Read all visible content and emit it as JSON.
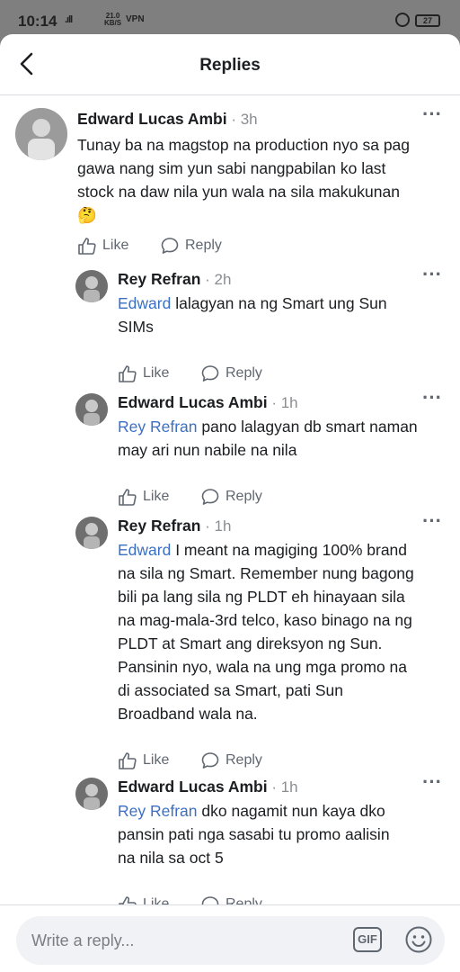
{
  "status_bar": {
    "time": "10:14",
    "signal": ".ıll",
    "speed_value": "21.0",
    "speed_unit": "KB/S",
    "vpn": "VPN",
    "battery": "27"
  },
  "header": {
    "title": "Replies",
    "back_icon": "chevron-left-icon"
  },
  "actions": {
    "like_label": "Like",
    "reply_label": "Reply"
  },
  "comments": [
    {
      "author": "Edward Lucas Ambi",
      "time": " · 3h",
      "lines": [
        "Tunay ba na magstop na production nyo sa pag",
        "gawa nang sim yun sabi nangpabilan ko last",
        "stock na daw nila yun wala na sila makukunan",
        "🤔"
      ]
    },
    {
      "author": "Rey Refran",
      "time": " · 2h",
      "mention": "Edward",
      "lines": [
        " lalagyan na ng Smart ung Sun",
        "SIMs"
      ]
    },
    {
      "author": "Edward Lucas Ambi",
      "time": " · 1h",
      "mention": "Rey Refran",
      "lines": [
        " pano lalagyan db smart naman",
        "may ari nun nabile na nila"
      ]
    },
    {
      "author": "Rey Refran",
      "time": " · 1h",
      "mention": "Edward",
      "lines": [
        " I meant na magiging 100% brand",
        "na sila ng Smart. Remember nung bagong",
        "bili pa lang sila ng PLDT eh hinayaan sila",
        "na mag-mala-3rd telco, kaso binago na ng",
        "PLDT at Smart ang direksyon ng Sun.",
        "Pansinin nyo, wala na ung mga promo na",
        "di associated sa Smart, pati Sun",
        "Broadband wala na."
      ]
    },
    {
      "author": "Edward Lucas Ambi",
      "time": " · 1h",
      "mention": "Rey Refran",
      "lines": [
        " dko nagamit nun kaya dko",
        "pansin pati nga sasabi tu promo aalisin",
        "na nila sa oct 5"
      ]
    }
  ],
  "composer": {
    "placeholder": "Write a reply...",
    "gif_label": "GIF",
    "emoji_icon": "smiley-icon"
  },
  "colors": {
    "mention": "#3b6fc4",
    "muted": "#606770",
    "input_bg": "#f0f2f5"
  }
}
